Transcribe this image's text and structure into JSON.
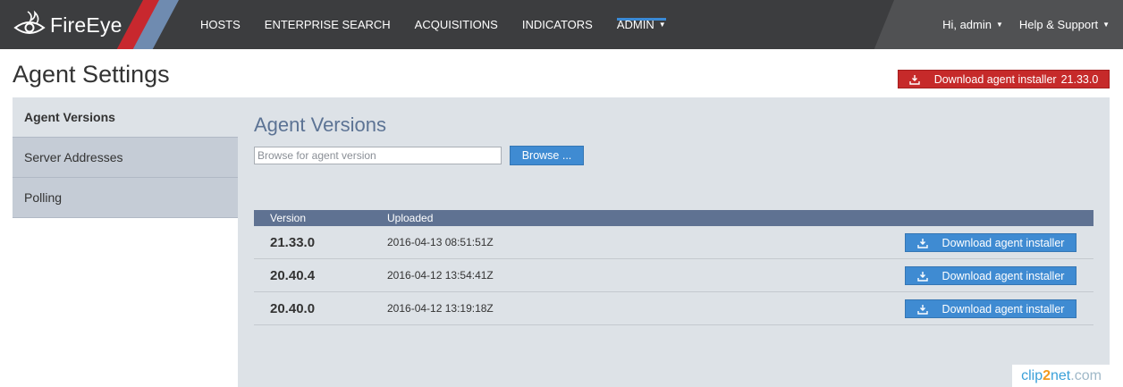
{
  "brand": {
    "name": "FireEye"
  },
  "nav": {
    "items": [
      {
        "label": "HOSTS"
      },
      {
        "label": "ENTERPRISE SEARCH"
      },
      {
        "label": "ACQUISITIONS"
      },
      {
        "label": "INDICATORS"
      },
      {
        "label": "ADMIN",
        "active": true
      }
    ],
    "user_menu": "Hi, admin",
    "help_menu": "Help & Support"
  },
  "page": {
    "title": "Agent Settings",
    "download_button_label": "Download agent installer",
    "download_button_version": "21.33.0"
  },
  "sidebar": {
    "items": [
      {
        "label": "Agent Versions",
        "active": true
      },
      {
        "label": "Server Addresses"
      },
      {
        "label": "Polling"
      }
    ]
  },
  "panel": {
    "title": "Agent Versions",
    "browse_placeholder": "Browse for agent version",
    "browse_button": "Browse ...",
    "table": {
      "columns": [
        "Version",
        "Uploaded"
      ],
      "rows": [
        {
          "version": "21.33.0",
          "uploaded": "2016-04-13 08:51:51Z",
          "action": "Download agent installer"
        },
        {
          "version": "20.40.4",
          "uploaded": "2016-04-12 13:54:41Z",
          "action": "Download agent installer"
        },
        {
          "version": "20.40.0",
          "uploaded": "2016-04-12 13:19:18Z",
          "action": "Download agent installer"
        }
      ]
    }
  },
  "watermark": {
    "part1": "clip",
    "part2": "2",
    "part3": "net",
    "part4": ".com"
  },
  "colors": {
    "topbar": "#3c3d3f",
    "accent_red": "#c62a2a",
    "accent_blue": "#3f8bd2",
    "table_header": "#5f7292",
    "panel_bg": "#dde2e7"
  }
}
